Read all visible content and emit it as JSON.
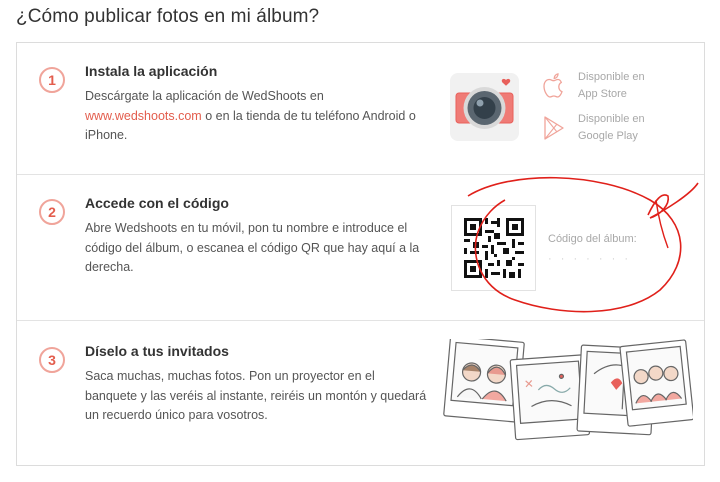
{
  "page_title": "¿Cómo publicar fotos en mi álbum?",
  "steps": [
    {
      "number": "1",
      "title": "Instala la aplicación",
      "text_before_link": "Descárgate la aplicación de WedShoots en",
      "link": "www.wedshoots.com",
      "text_after_link": "o en la tienda de tu teléfono Android o iPhone."
    },
    {
      "number": "2",
      "title": "Accede con el código",
      "text": "Abre Wedshoots en tu móvil, pon tu nombre e introduce el código del álbum, o escanea el código QR que hay aquí a la derecha."
    },
    {
      "number": "3",
      "title": "Díselo a tus invitados",
      "text": "Saca muchas, muchas fotos. Pon un proyector en el banquete y las veréis al instante, reiréis un montón y quedará un recuerdo único para vosotros."
    }
  ],
  "stores": {
    "app_store_line1": "Disponible en",
    "app_store_line2": "App Store",
    "google_play_line1": "Disponible en",
    "google_play_line2": "Google Play"
  },
  "album": {
    "code_label": "Código del álbum:",
    "code_value": "· · · · · · ·"
  },
  "colors": {
    "accent": "#e35d4d",
    "step_ring": "#f0a49a",
    "annotation": "#e0201a"
  }
}
